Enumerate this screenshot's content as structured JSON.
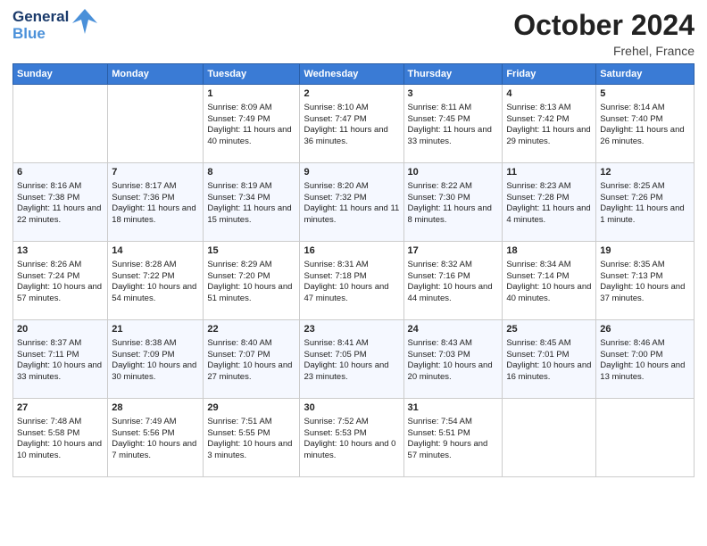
{
  "header": {
    "logo_general": "General",
    "logo_blue": "Blue",
    "month": "October 2024",
    "location": "Frehel, France"
  },
  "columns": [
    "Sunday",
    "Monday",
    "Tuesday",
    "Wednesday",
    "Thursday",
    "Friday",
    "Saturday"
  ],
  "rows": [
    [
      {
        "day": "",
        "content": ""
      },
      {
        "day": "",
        "content": ""
      },
      {
        "day": "1",
        "content": "Sunrise: 8:09 AM\nSunset: 7:49 PM\nDaylight: 11 hours and 40 minutes."
      },
      {
        "day": "2",
        "content": "Sunrise: 8:10 AM\nSunset: 7:47 PM\nDaylight: 11 hours and 36 minutes."
      },
      {
        "day": "3",
        "content": "Sunrise: 8:11 AM\nSunset: 7:45 PM\nDaylight: 11 hours and 33 minutes."
      },
      {
        "day": "4",
        "content": "Sunrise: 8:13 AM\nSunset: 7:42 PM\nDaylight: 11 hours and 29 minutes."
      },
      {
        "day": "5",
        "content": "Sunrise: 8:14 AM\nSunset: 7:40 PM\nDaylight: 11 hours and 26 minutes."
      }
    ],
    [
      {
        "day": "6",
        "content": "Sunrise: 8:16 AM\nSunset: 7:38 PM\nDaylight: 11 hours and 22 minutes."
      },
      {
        "day": "7",
        "content": "Sunrise: 8:17 AM\nSunset: 7:36 PM\nDaylight: 11 hours and 18 minutes."
      },
      {
        "day": "8",
        "content": "Sunrise: 8:19 AM\nSunset: 7:34 PM\nDaylight: 11 hours and 15 minutes."
      },
      {
        "day": "9",
        "content": "Sunrise: 8:20 AM\nSunset: 7:32 PM\nDaylight: 11 hours and 11 minutes."
      },
      {
        "day": "10",
        "content": "Sunrise: 8:22 AM\nSunset: 7:30 PM\nDaylight: 11 hours and 8 minutes."
      },
      {
        "day": "11",
        "content": "Sunrise: 8:23 AM\nSunset: 7:28 PM\nDaylight: 11 hours and 4 minutes."
      },
      {
        "day": "12",
        "content": "Sunrise: 8:25 AM\nSunset: 7:26 PM\nDaylight: 11 hours and 1 minute."
      }
    ],
    [
      {
        "day": "13",
        "content": "Sunrise: 8:26 AM\nSunset: 7:24 PM\nDaylight: 10 hours and 57 minutes."
      },
      {
        "day": "14",
        "content": "Sunrise: 8:28 AM\nSunset: 7:22 PM\nDaylight: 10 hours and 54 minutes."
      },
      {
        "day": "15",
        "content": "Sunrise: 8:29 AM\nSunset: 7:20 PM\nDaylight: 10 hours and 51 minutes."
      },
      {
        "day": "16",
        "content": "Sunrise: 8:31 AM\nSunset: 7:18 PM\nDaylight: 10 hours and 47 minutes."
      },
      {
        "day": "17",
        "content": "Sunrise: 8:32 AM\nSunset: 7:16 PM\nDaylight: 10 hours and 44 minutes."
      },
      {
        "day": "18",
        "content": "Sunrise: 8:34 AM\nSunset: 7:14 PM\nDaylight: 10 hours and 40 minutes."
      },
      {
        "day": "19",
        "content": "Sunrise: 8:35 AM\nSunset: 7:13 PM\nDaylight: 10 hours and 37 minutes."
      }
    ],
    [
      {
        "day": "20",
        "content": "Sunrise: 8:37 AM\nSunset: 7:11 PM\nDaylight: 10 hours and 33 minutes."
      },
      {
        "day": "21",
        "content": "Sunrise: 8:38 AM\nSunset: 7:09 PM\nDaylight: 10 hours and 30 minutes."
      },
      {
        "day": "22",
        "content": "Sunrise: 8:40 AM\nSunset: 7:07 PM\nDaylight: 10 hours and 27 minutes."
      },
      {
        "day": "23",
        "content": "Sunrise: 8:41 AM\nSunset: 7:05 PM\nDaylight: 10 hours and 23 minutes."
      },
      {
        "day": "24",
        "content": "Sunrise: 8:43 AM\nSunset: 7:03 PM\nDaylight: 10 hours and 20 minutes."
      },
      {
        "day": "25",
        "content": "Sunrise: 8:45 AM\nSunset: 7:01 PM\nDaylight: 10 hours and 16 minutes."
      },
      {
        "day": "26",
        "content": "Sunrise: 8:46 AM\nSunset: 7:00 PM\nDaylight: 10 hours and 13 minutes."
      }
    ],
    [
      {
        "day": "27",
        "content": "Sunrise: 7:48 AM\nSunset: 5:58 PM\nDaylight: 10 hours and 10 minutes."
      },
      {
        "day": "28",
        "content": "Sunrise: 7:49 AM\nSunset: 5:56 PM\nDaylight: 10 hours and 7 minutes."
      },
      {
        "day": "29",
        "content": "Sunrise: 7:51 AM\nSunset: 5:55 PM\nDaylight: 10 hours and 3 minutes."
      },
      {
        "day": "30",
        "content": "Sunrise: 7:52 AM\nSunset: 5:53 PM\nDaylight: 10 hours and 0 minutes."
      },
      {
        "day": "31",
        "content": "Sunrise: 7:54 AM\nSunset: 5:51 PM\nDaylight: 9 hours and 57 minutes."
      },
      {
        "day": "",
        "content": ""
      },
      {
        "day": "",
        "content": ""
      }
    ]
  ]
}
